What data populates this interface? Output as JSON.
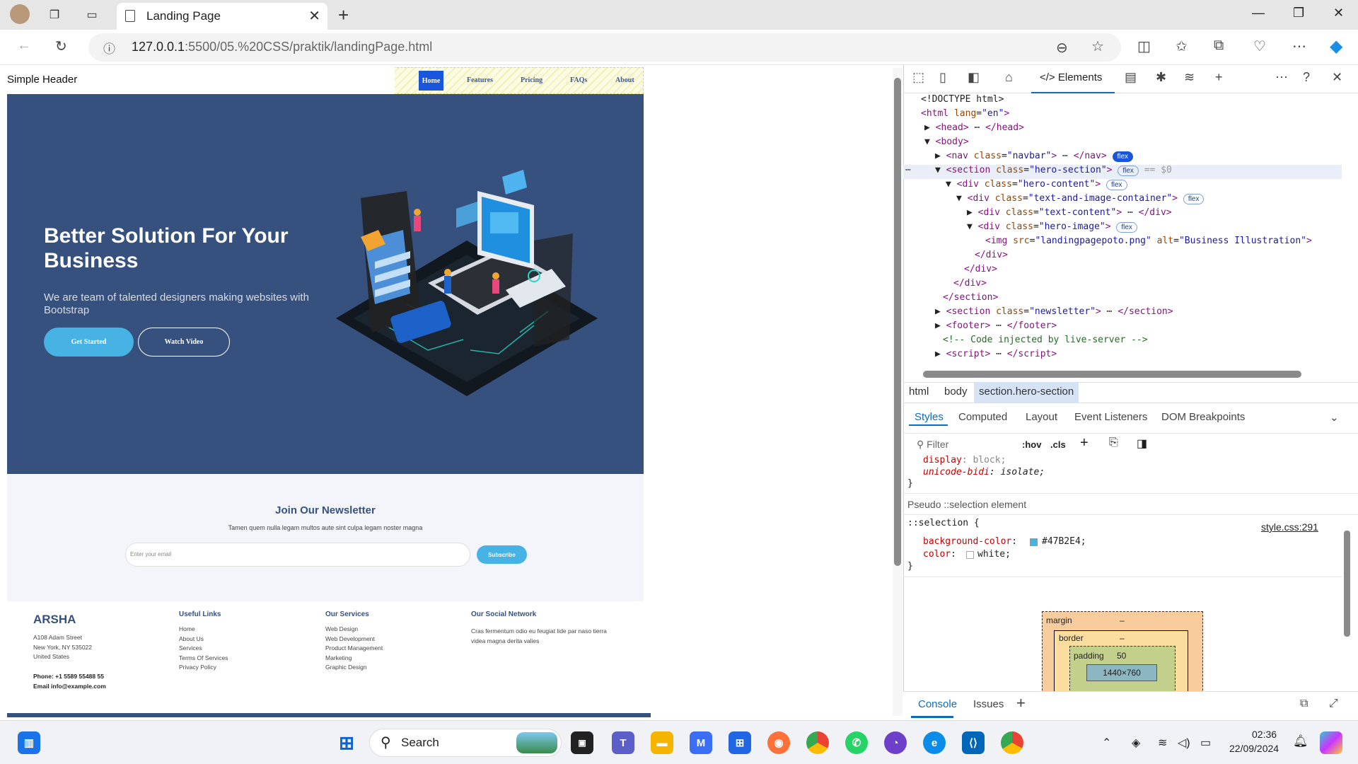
{
  "browser": {
    "tab_title": "Landing Page",
    "url_host": "127.0.0.1",
    "url_rest": ":5500/05.%20CSS/praktik/landingPage.html"
  },
  "page": {
    "site_title": "Simple Header",
    "nav": [
      "Home",
      "Features",
      "Pricing",
      "FAQs",
      "About"
    ],
    "hero_title": "Better Solution For Your Business",
    "hero_subtitle": "We are team of talented designers making websites with Bootstrap",
    "btn_start": "Get Started",
    "btn_video": "Watch Video",
    "newsletter_title": "Join Our Newsletter",
    "newsletter_sub": "Tamen quem nulla legam multos aute sint culpa legam noster magna",
    "email_placeholder": "Enter your email",
    "subscribe": "Subscribe",
    "footer": {
      "brand": "ARSHA",
      "address": [
        "A108 Adam Street",
        "New York, NY 535022",
        "United States"
      ],
      "phone": "Phone: +1 5589 55488 55",
      "email": "Email info@example.com",
      "useful_title": "Useful Links",
      "useful_links": [
        "Home",
        "About Us",
        "Services",
        "Terms Of Services",
        "Privacy Policy"
      ],
      "services_title": "Our Services",
      "services": [
        "Web Design",
        "Web Development",
        "Product Management",
        "Marketing",
        "Graphic Design"
      ],
      "social_title": "Our Social Network",
      "social_text": "Cras fermentum odio eu feugiat lide par naso tierra videa magna derita valies"
    }
  },
  "devtools": {
    "active_tool": "Elements",
    "breadcrumb": [
      "html",
      "body",
      "section.hero-section"
    ],
    "style_tabs": [
      "Styles",
      "Computed",
      "Layout",
      "Event Listeners",
      "DOM Breakpoints"
    ],
    "filter_placeholder": "Filter",
    "hov": ":hov",
    "cls": ".cls",
    "pseudo_label": "Pseudo ::selection element",
    "selector": "::selection {",
    "stylesheet_link": "style.css:291",
    "bg_value": "#47B2E4;",
    "color_value": "white;",
    "box_model": {
      "margin": "margin",
      "border": "border",
      "padding": "padding",
      "padding_value": "50",
      "content": "1440×760",
      "dash": "–"
    },
    "bottom_tabs": [
      "Console",
      "Issues"
    ]
  },
  "taskbar": {
    "search": "Search",
    "time": "02:36",
    "date": "22/09/2024"
  }
}
